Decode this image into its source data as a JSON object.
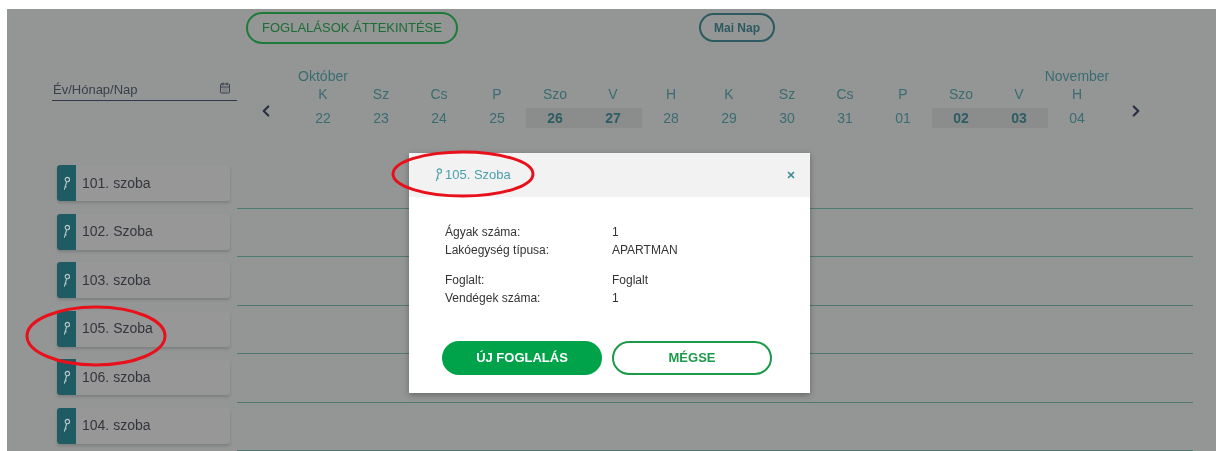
{
  "overview_button": {
    "label": "FOGLALÁSOK ÁTTEKINTÉSE"
  },
  "today_button": {
    "label": "Mai Nap"
  },
  "date_field": {
    "placeholder": "Év/Hónap/Nap"
  },
  "calendar": {
    "days": [
      {
        "month": "Október",
        "weekday": "K",
        "date": "22",
        "weekend": false
      },
      {
        "weekday": "Sz",
        "date": "23",
        "weekend": false
      },
      {
        "weekday": "Cs",
        "date": "24",
        "weekend": false
      },
      {
        "weekday": "P",
        "date": "25",
        "weekend": false
      },
      {
        "weekday": "Szo",
        "date": "26",
        "weekend": true
      },
      {
        "weekday": "V",
        "date": "27",
        "weekend": true
      },
      {
        "weekday": "H",
        "date": "28",
        "weekend": false
      },
      {
        "weekday": "K",
        "date": "29",
        "weekend": false
      },
      {
        "weekday": "Sz",
        "date": "30",
        "weekend": false
      },
      {
        "weekday": "Cs",
        "date": "31",
        "weekend": false
      },
      {
        "weekday": "P",
        "date": "01",
        "weekend": false
      },
      {
        "weekday": "Szo",
        "date": "02",
        "weekend": true
      },
      {
        "weekday": "V",
        "date": "03",
        "weekend": true
      },
      {
        "month": "November",
        "weekday": "H",
        "date": "04",
        "weekend": false
      }
    ]
  },
  "rooms": [
    {
      "label": "101. szoba"
    },
    {
      "label": "102. Szoba"
    },
    {
      "label": "103. szoba"
    },
    {
      "label": "105. Szoba"
    },
    {
      "label": "106. szoba"
    },
    {
      "label": "104. szoba"
    }
  ],
  "dialog": {
    "title": "105. Szoba",
    "groups": [
      [
        {
          "label": "Ágyak száma:",
          "value": "1"
        },
        {
          "label": "Lakóegység típusa:",
          "value": "APARTMAN"
        }
      ],
      [
        {
          "label": "Foglalt:",
          "value": "Foglalt"
        },
        {
          "label": "Vendégek száma:",
          "value": "1"
        }
      ]
    ],
    "buttons": [
      {
        "label": "ÚJ FOGLALÁS",
        "kind": "primary"
      },
      {
        "label": "MÉGSE",
        "kind": "secondary"
      }
    ]
  }
}
